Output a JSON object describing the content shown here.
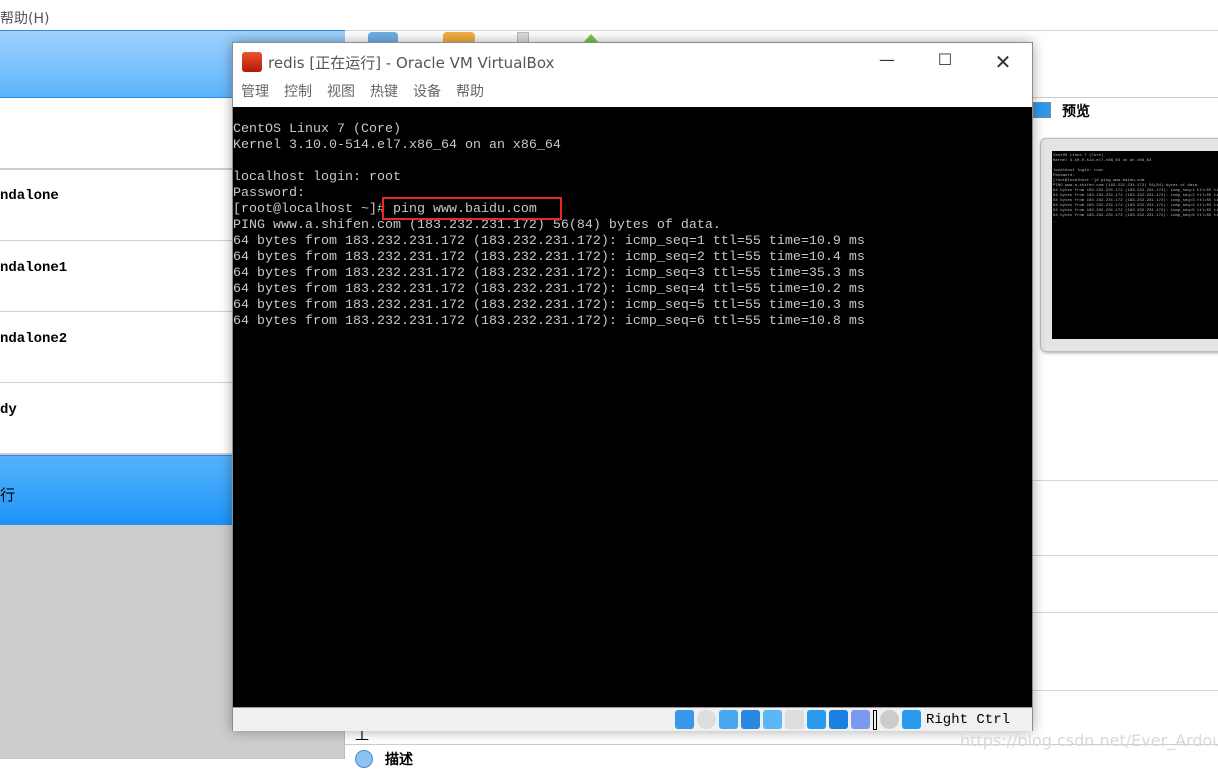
{
  "host": {
    "menu_help": "帮助(H)",
    "vm_list": [
      {
        "label": ""
      },
      {
        "label": "ndalone"
      },
      {
        "label": "ndalone1"
      },
      {
        "label": "ndalone2"
      },
      {
        "label": "dy"
      }
    ],
    "selected_bottom_label": "行",
    "preview_title": "预览",
    "section_gong": "工",
    "section_desc": "描述",
    "watermark": "https://blog.csdn.net/Ever_Ardour"
  },
  "vm_window": {
    "title": "redis [正在运行] - Oracle VM VirtualBox",
    "menu": [
      "管理",
      "控制",
      "视图",
      "热键",
      "设备",
      "帮助"
    ],
    "terminal_lines": [
      "CentOS Linux 7 (Core)",
      "Kernel 3.10.0-514.el7.x86_64 on an x86_64",
      "",
      "localhost login: root",
      "Password:",
      "[root@localhost ~]# ping www.baidu.com",
      "PING www.a.shifen.com (183.232.231.172) 56(84) bytes of data.",
      "64 bytes from 183.232.231.172 (183.232.231.172): icmp_seq=1 ttl=55 time=10.9 ms",
      "64 bytes from 183.232.231.172 (183.232.231.172): icmp_seq=2 ttl=55 time=10.4 ms",
      "64 bytes from 183.232.231.172 (183.232.231.172): icmp_seq=3 ttl=55 time=35.3 ms",
      "64 bytes from 183.232.231.172 (183.232.231.172): icmp_seq=4 ttl=55 time=10.2 ms",
      "64 bytes from 183.232.231.172 (183.232.231.172): icmp_seq=5 ttl=55 time=10.3 ms",
      "64 bytes from 183.232.231.172 (183.232.231.172): icmp_seq=6 ttl=55 time=10.8 ms"
    ],
    "host_key": "Right Ctrl",
    "status_icons": [
      "hard-disk-icon",
      "optical-drive-icon",
      "audio-icon",
      "network-icon",
      "usb-icon",
      "shared-folder-icon",
      "display-icon",
      "video-capture-icon",
      "cpu-virtualization-icon",
      "mouse-integration-icon",
      "keyboard-capture-icon"
    ]
  },
  "colors": {
    "selection": "#5db4fb",
    "highlight_box": "#e52a2a"
  }
}
